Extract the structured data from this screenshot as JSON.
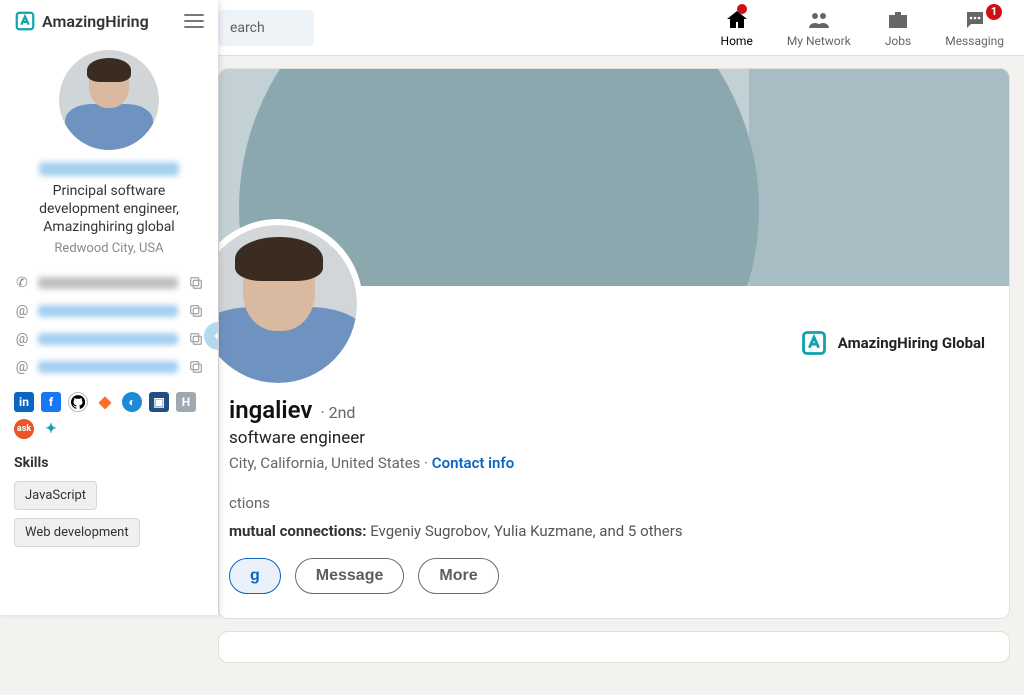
{
  "sidebar": {
    "brand": "AmazingHiring",
    "role": "Principal software development engineer, Amazinghiring global",
    "location": "Redwood City, USA",
    "skills_heading": "Skills",
    "skills": [
      "JavaScript",
      "Web development"
    ],
    "social_icons": [
      "linkedin",
      "facebook",
      "github",
      "gitlab",
      "spinner",
      "bitbucket",
      "habr",
      "ask",
      "amazinghiring"
    ]
  },
  "topbar": {
    "search_fragment": "earch",
    "nav": {
      "home": {
        "label": "Home",
        "badge": ""
      },
      "network": {
        "label": "My Network",
        "badge": null
      },
      "jobs": {
        "label": "Jobs",
        "badge": null
      },
      "messaging": {
        "label": "Messaging",
        "badge": "1"
      }
    }
  },
  "profile": {
    "name_fragment": "ingaliev",
    "degree": "· 2nd",
    "headline_fragment": "software engineer",
    "location_fragment": "City, California, United States ·",
    "contact_info": "Contact info",
    "connections_fragment": "ctions",
    "mutual_label": "mutual connections:",
    "mutual_text": "Evgeniy Sugrobov, Yulia Kuzmane, and 5 others",
    "company": "AmazingHiring Global",
    "actions": {
      "pending_fragment": "g",
      "message": "Message",
      "more": "More"
    }
  }
}
